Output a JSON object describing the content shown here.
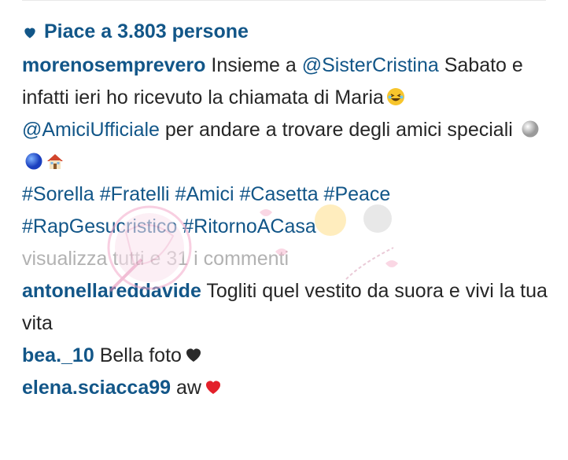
{
  "likes": {
    "text": "Piace a 3.803 persone",
    "icon": "heart-icon"
  },
  "caption": {
    "username": "morenosemprevero",
    "t1": "Insieme a",
    "mention1": "@SisterCristina",
    "t2": "Sabato e infatti ieri ho ricevuto la chiamata di Maria",
    "mention2": "@AmiciUfficiale",
    "t3": "per andare a trovare degli amici speciali",
    "hashtags_line1": [
      "#Sorella",
      "#Fratelli",
      "#Amici",
      "#Casetta",
      "#Peace"
    ],
    "hashtags_line2": [
      "#RapGesucristico",
      "#RitornoACasa"
    ]
  },
  "view_all_comments": "visualizza tutti e 31 i commenti",
  "comments": [
    {
      "username": "antonellareddavide",
      "text": "Togliti quel vestito da suora e vivi la tua vita"
    },
    {
      "username": "bea._10",
      "text": "Bella foto"
    },
    {
      "username": "elena.sciacca99",
      "text": "aw"
    }
  ],
  "colors": {
    "link": "#125688",
    "text": "#262626",
    "muted": "#b2b2b2"
  },
  "emoji_icons": [
    "laughing-face-icon",
    "white-circle-icon",
    "blue-circle-icon",
    "house-icon",
    "black-heart-icon",
    "red-heart-icon"
  ]
}
